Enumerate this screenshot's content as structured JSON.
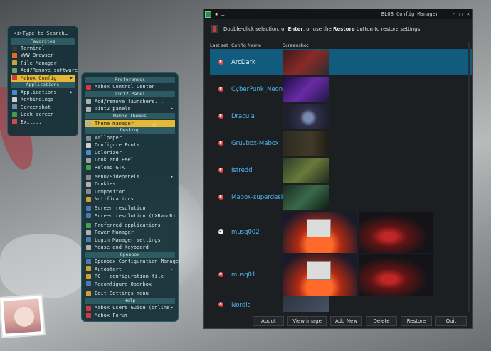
{
  "menu1": {
    "search": "<i>Type to Search…",
    "sections": {
      "favorites": "Favorites",
      "applications": "Applications"
    },
    "favorites": [
      {
        "label": "Terminal",
        "icon": "terminal-icon",
        "color": "#3a3a3a"
      },
      {
        "label": "WWW Browser",
        "icon": "browser-icon",
        "color": "#e86a2a"
      },
      {
        "label": "File Manager",
        "icon": "folder-icon",
        "color": "#c9a241"
      },
      {
        "label": "Add/Remove software",
        "icon": "package-icon",
        "color": "#6aa56a"
      },
      {
        "label": "Mabox Config",
        "icon": "config-icon",
        "color": "#d03a3a",
        "selected": true
      }
    ],
    "applications": [
      {
        "label": "Applications",
        "icon": "apps-icon",
        "color": "#4a8ad0"
      },
      {
        "label": "Keybindings",
        "icon": "keyboard-icon",
        "color": "#cfcfcf"
      },
      {
        "label": "Screenshot",
        "icon": "camera-icon",
        "color": "#6a90b0"
      },
      {
        "label": "Lock screen",
        "icon": "lock-icon",
        "color": "#4a9a4a"
      },
      {
        "label": "Exit...",
        "icon": "exit-icon",
        "color": "#d04a4a"
      }
    ]
  },
  "menu2": {
    "sections": {
      "preferences": "Preferences",
      "tint2": "Tint2 Panel",
      "themes": "Mabox Themes",
      "desktop": "Desktop",
      "openbox": "Openbox",
      "help": "Help"
    },
    "preferences": [
      {
        "label": "Mabox Control Center",
        "icon": "control-center-icon",
        "color": "#d03a3a"
      }
    ],
    "tint2": [
      {
        "label": "Add/remove launchers...",
        "icon": "launcher-icon",
        "color": "#b0b0b0"
      },
      {
        "label": "Tint2 panels",
        "icon": "panel-icon",
        "color": "#b0b0b0"
      }
    ],
    "themes": [
      {
        "label": "Theme manager",
        "icon": "theme-icon",
        "color": "#b0b0b0",
        "selected": true
      }
    ],
    "desktop1": [
      {
        "label": "Wallpaper",
        "icon": "wallpaper-icon",
        "color": "#8a8a8a"
      },
      {
        "label": "Configure Fonts",
        "icon": "font-icon",
        "color": "#cfcfcf"
      },
      {
        "label": "Colorizer",
        "icon": "colorizer-icon",
        "color": "#4a8ad0"
      },
      {
        "label": "Look and Feel",
        "icon": "look-feel-icon",
        "color": "#a0a0a0"
      },
      {
        "label": "Reload GTK",
        "icon": "reload-icon",
        "color": "#4aa04a"
      }
    ],
    "desktop2": [
      {
        "label": "Menu/Sidepanels",
        "icon": "menu-icon",
        "color": "#8a8a8a"
      },
      {
        "label": "Conkies",
        "icon": "conky-icon",
        "color": "#b0b0b0"
      },
      {
        "label": "Compositor",
        "icon": "compositor-icon",
        "color": "#8a8a8a"
      },
      {
        "label": "Notifications",
        "icon": "bell-icon",
        "color": "#d0a030"
      }
    ],
    "desktop3": [
      {
        "label": "Screen resolution",
        "icon": "monitor-icon",
        "color": "#4a7ab0"
      },
      {
        "label": "Screen resolution (LXRandR)",
        "icon": "monitor-icon",
        "color": "#4a7ab0"
      }
    ],
    "desktop4": [
      {
        "label": "Preferred applications",
        "icon": "preferred-apps-icon",
        "color": "#4aa04a"
      },
      {
        "label": "Power Manager",
        "icon": "power-icon",
        "color": "#b0b0b0"
      },
      {
        "label": "Login Manager settings",
        "icon": "login-icon",
        "color": "#4a7ab0"
      },
      {
        "label": "Mouse and Keyboard",
        "icon": "mouse-icon",
        "color": "#b0b0b0"
      }
    ],
    "openbox": [
      {
        "label": "Openbox Configuration Manager",
        "icon": "openbox-icon",
        "color": "#4a7ab0"
      },
      {
        "label": "Autostart",
        "icon": "autostart-icon",
        "color": "#d0a030",
        "arrow": true
      },
      {
        "label": "RC - configuration file",
        "icon": "file-icon",
        "color": "#d0a030"
      },
      {
        "label": "Reconfigure Openbox",
        "icon": "reconfigure-icon",
        "color": "#4a7ab0"
      }
    ],
    "openbox2": [
      {
        "label": "Edit Settings menu",
        "icon": "edit-icon",
        "color": "#d0a030"
      }
    ],
    "help": [
      {
        "label": "Mabox Users Guide (online)",
        "icon": "guide-icon",
        "color": "#d03a3a",
        "arrow": true
      },
      {
        "label": "Mabox Forum",
        "icon": "forum-icon",
        "color": "#d03a3a"
      }
    ]
  },
  "window": {
    "title": "BLOB Config Manager",
    "controls": [
      "-",
      "□",
      "×"
    ],
    "instruction_pre": "Double-click selection, or ",
    "instruction_enter": "Enter",
    "instruction_mid": ", or use the ",
    "instruction_restore": "Restore",
    "instruction_post": " button to restore settings",
    "columns": [
      "Last set",
      "Config Name",
      "Screenshot"
    ],
    "rows": [
      {
        "name": "ArcDark",
        "status": "x",
        "selected": true
      },
      {
        "name": "CyberPunk_Neon",
        "status": "x"
      },
      {
        "name": "Dracula",
        "status": "x"
      },
      {
        "name": "Gruvbox-Mabox",
        "status": "x"
      },
      {
        "name": "Istredd",
        "status": "x"
      },
      {
        "name": "Mabox-superdesk",
        "status": "x"
      },
      {
        "name": "musq002",
        "status": "ok"
      },
      {
        "name": "musq01",
        "status": "x"
      },
      {
        "name": "Nordic",
        "status": "x"
      }
    ],
    "buttons": [
      "About",
      "View image",
      "Add New",
      "Delete",
      "Restore",
      "Quit"
    ]
  },
  "colors": {
    "menu_bg": "#153038",
    "menu_highlight": "#e5b935",
    "selected_row": "#115b7f",
    "config_name": "#4fb3ee",
    "status_x": "#e04646"
  }
}
